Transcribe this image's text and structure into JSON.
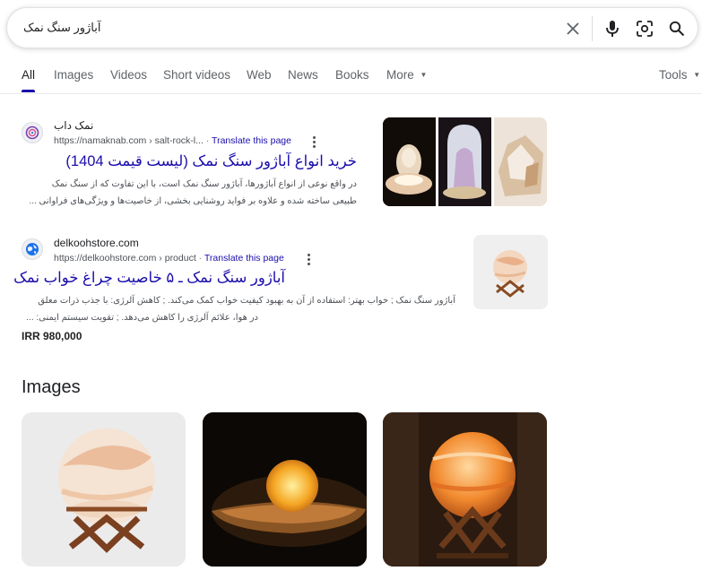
{
  "search": {
    "query": "آباژور سنگ نمک",
    "icons": [
      "close-icon",
      "mic-icon",
      "lens-icon",
      "search-icon"
    ]
  },
  "tabs": [
    {
      "label": "All",
      "active": true
    },
    {
      "label": "Images"
    },
    {
      "label": "Videos"
    },
    {
      "label": "Short videos"
    },
    {
      "label": "Web"
    },
    {
      "label": "News"
    },
    {
      "label": "Books"
    },
    {
      "label": "More"
    }
  ],
  "tools_label": "Tools",
  "results": [
    {
      "site_name": "نمک داب",
      "url": "https://namaknab.com › salt-rock-l...",
      "translate": "Translate this page",
      "title": "خرید انواع آباژور سنگ نمک (لیست قیمت 1404)",
      "snippet": [
        "در واقع نوعی از انواع آباژورها، آباژور سنگ نمک است، با این تفاوت که از سنگ نمک",
        "طبیعی ساخته شده و علاوه بر فواید روشنایی بخشی، از خاصیت‌ها و ویژگی‌های فراوانی ..."
      ]
    },
    {
      "site_name": "delkoohstore.com",
      "url": "https://delkoohstore.com › product",
      "translate": "Translate this page",
      "title": "آباژور سنگ نمک ـ ۵ خاصیت چراغ خواب نمک",
      "snippet": [
        "آباژور سنگ نمک ; خواب بهتر: استفاده از آن به بهبود کیفیت خواب کمک می‌کند. ; کاهش آلرژی: با جذب ذرات معلق",
        "در هوا، علائم آلرژی را کاهش می‌دهد. ; تقویت سیستم ایمنی: ..."
      ],
      "price": "IRR 980,000"
    }
  ],
  "images_section": {
    "title": "Images"
  },
  "colors": {
    "link": "#1a0dab",
    "text": "#202124",
    "muted": "#4d5156"
  }
}
